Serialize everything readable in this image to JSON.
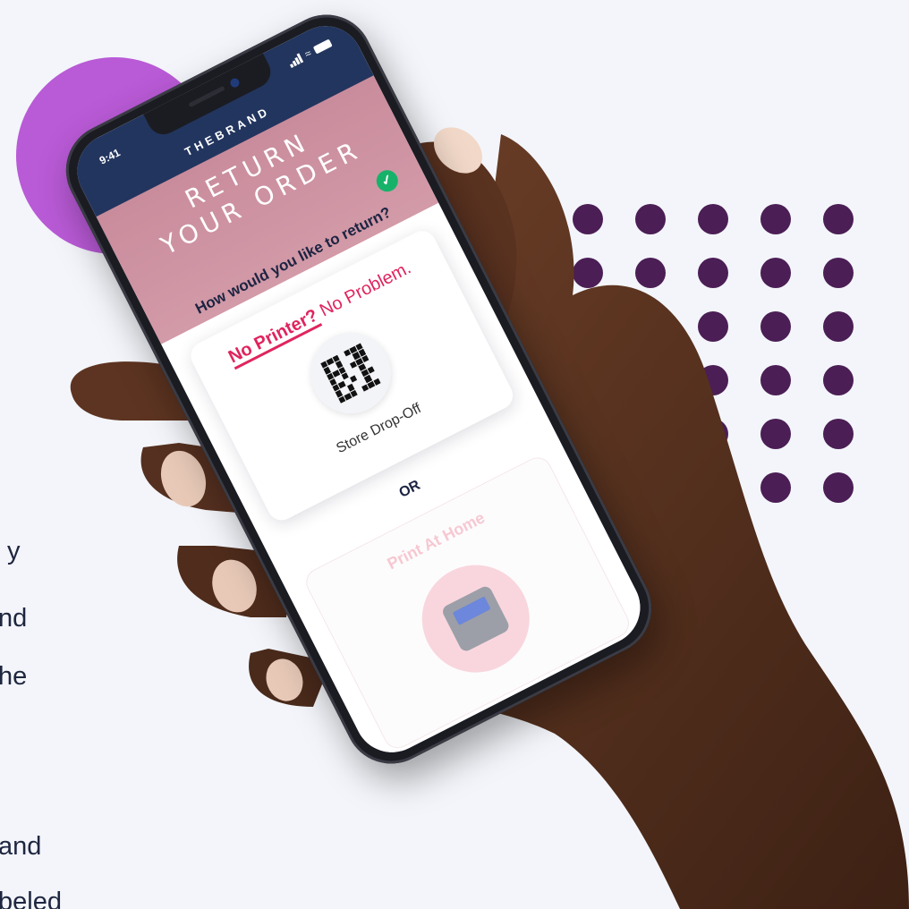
{
  "background": {
    "page": "#f3f5fa",
    "accent_circle": "#b95ad6",
    "dot_color": "#4b1e55"
  },
  "side_text": [
    "y",
    "nd",
    "he",
    "and",
    "beled"
  ],
  "phone": {
    "status": {
      "time": "9:41"
    },
    "brand": "THEBRAND",
    "hero_title_line1": "RETURN",
    "hero_title_line2": "YOUR ORDER",
    "question": "How would you like to return?",
    "option1": {
      "headline_strong": "No Printer?",
      "headline_rest": "No Problem.",
      "label": "Store Drop-Off",
      "icon": "qr-code-icon",
      "selected": true
    },
    "divider": "OR",
    "option2": {
      "headline": "Print At Home",
      "icon": "printer-icon",
      "selected": false
    },
    "colors": {
      "header": "#22355e",
      "hero": "#d39aa8",
      "accent": "#e0245e",
      "check": "#17b26a"
    }
  }
}
